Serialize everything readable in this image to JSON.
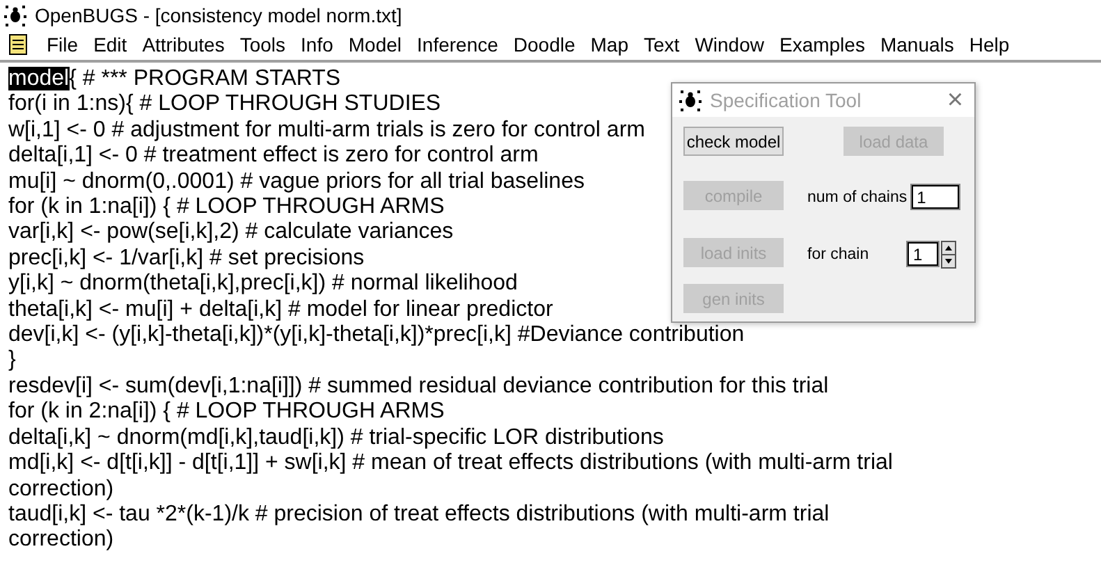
{
  "window": {
    "title": "OpenBUGS - [consistency model norm.txt]"
  },
  "menu": [
    "File",
    "Edit",
    "Attributes",
    "Tools",
    "Info",
    "Model",
    "Inference",
    "Doodle",
    "Map",
    "Text",
    "Window",
    "Examples",
    "Manuals",
    "Help"
  ],
  "editor": {
    "lines": [
      {
        "selected_text": "model",
        "text": "{ # *** PROGRAM STARTS"
      },
      {
        "text": "for(i in 1:ns){ # LOOP THROUGH STUDIES"
      },
      {
        "text": "w[i,1] <- 0 # adjustment for multi-arm trials is zero for control arm"
      },
      {
        "text": "delta[i,1] <- 0 # treatment effect is zero for control arm"
      },
      {
        "text": "mu[i] ~ dnorm(0,.0001) # vague priors for all trial baselines"
      },
      {
        "text": "for (k in 1:na[i]) { # LOOP THROUGH ARMS"
      },
      {
        "text": "var[i,k] <- pow(se[i,k],2) # calculate variances"
      },
      {
        "text": "prec[i,k] <- 1/var[i,k] # set precisions"
      },
      {
        "text": "y[i,k] ~ dnorm(theta[i,k],prec[i,k]) # normal likelihood"
      },
      {
        "text": "theta[i,k] <- mu[i] + delta[i,k] # model for linear predictor"
      },
      {
        "text": "dev[i,k] <- (y[i,k]-theta[i,k])*(y[i,k]-theta[i,k])*prec[i,k] #Deviance contribution"
      },
      {
        "text": "}"
      },
      {
        "text": "resdev[i] <- sum(dev[i,1:na[i]]) # summed residual deviance contribution for this trial"
      },
      {
        "text": "for (k in 2:na[i]) { # LOOP THROUGH ARMS"
      },
      {
        "text": "delta[i,k] ~ dnorm(md[i,k],taud[i,k]) # trial-specific LOR distributions"
      },
      {
        "text": "md[i,k] <- d[t[i,k]] - d[t[i,1]] + sw[i,k] # mean of treat effects distributions (with multi-arm trial"
      },
      {
        "text": "correction)"
      },
      {
        "text": "taud[i,k] <- tau *2*(k-1)/k # precision of treat effects distributions (with multi-arm trial"
      },
      {
        "text": "correction)"
      }
    ]
  },
  "dialog": {
    "title": "Specification Tool",
    "close": "×",
    "buttons": [
      {
        "label": "check model",
        "disabled": false
      },
      {
        "label": "load data",
        "disabled": true
      },
      {
        "label": "compile",
        "disabled": true
      },
      {
        "label": "load inits",
        "disabled": true
      },
      {
        "label": "gen inits",
        "disabled": true
      }
    ],
    "num_chains": {
      "label": "num of chains",
      "value": "1"
    },
    "for_chain": {
      "label": "for chain",
      "value": "1"
    }
  }
}
